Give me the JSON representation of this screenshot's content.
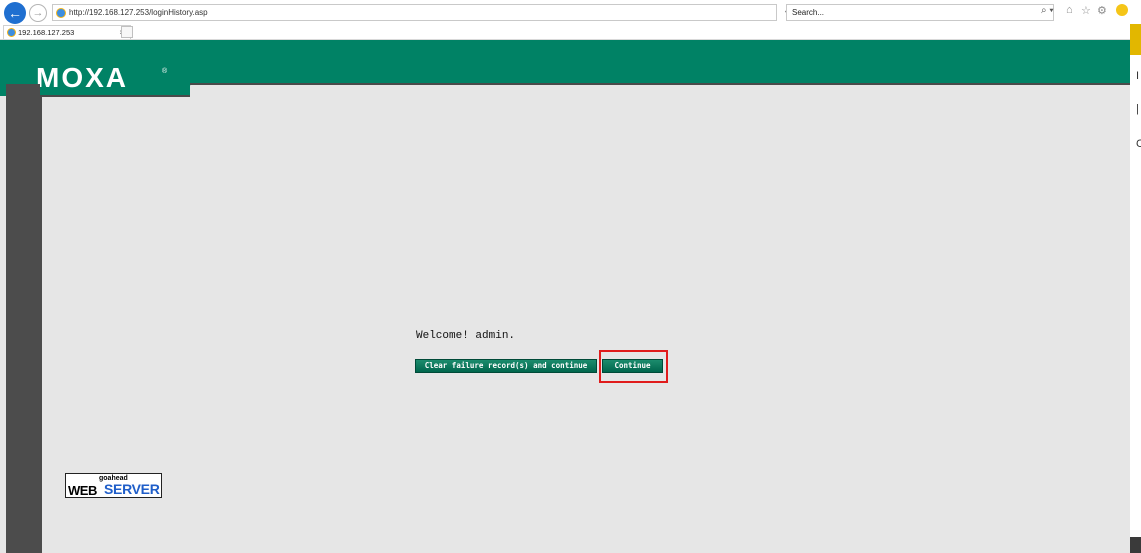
{
  "browser": {
    "url": "http://192.168.127.253/loginHistory.asp",
    "refresh_label": "▾ C",
    "search_placeholder": "Search...",
    "search_glyph": "⌕ ▾",
    "tab": {
      "title": "192.168.127.253",
      "close_glyph": "×"
    }
  },
  "right_edge": {
    "fragments": [
      "I",
      "|",
      "C"
    ]
  },
  "page": {
    "logo_text": "MOXA",
    "logo_reg": "®",
    "welcome_text": "Welcome! admin.",
    "buttons": {
      "clear_label": "Clear failure record(s) and continue",
      "continue_label": "Continue"
    },
    "footer_badge": {
      "small": "goahead",
      "web": "WEB",
      "server": "SERVER"
    }
  },
  "colors": {
    "header_green": "#008265",
    "button_green": "#00664d",
    "page_bg": "#e6e6e6",
    "highlight": "#e01c1c"
  }
}
